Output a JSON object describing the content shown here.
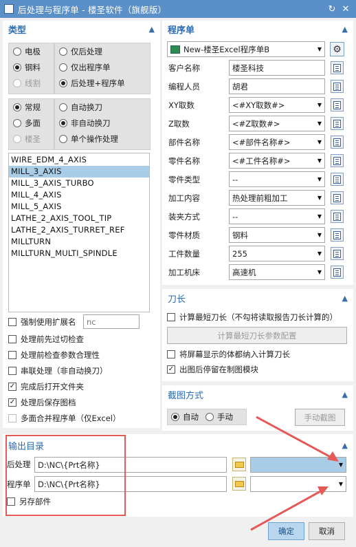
{
  "window": {
    "title": "后处理与程序单 - 楼圣软件（旗舰版）",
    "reset_icon": "refresh-icon",
    "close_icon": "close-icon"
  },
  "type_section": {
    "title": "类型",
    "radio_group1": {
      "left": [
        {
          "label": "电极",
          "checked": false,
          "disabled": false
        },
        {
          "label": "钢料",
          "checked": true,
          "disabled": false
        },
        {
          "label": "线割",
          "checked": false,
          "disabled": true
        }
      ],
      "right": [
        {
          "label": "仅后处理",
          "checked": false
        },
        {
          "label": "仅出程序单",
          "checked": false
        },
        {
          "label": "后处理+程序单",
          "checked": true
        }
      ]
    },
    "radio_group2": {
      "left": [
        {
          "label": "常规",
          "checked": true,
          "disabled": false
        },
        {
          "label": "多面",
          "checked": false,
          "disabled": false
        },
        {
          "label": "楼圣",
          "checked": false,
          "disabled": true
        }
      ],
      "right": [
        {
          "label": "自动换刀",
          "checked": false
        },
        {
          "label": "非自动换刀",
          "checked": true
        },
        {
          "label": "单个操作处理",
          "checked": false
        }
      ]
    },
    "postprocessors": [
      "WIRE_EDM_4_AXIS",
      "MILL_3_AXIS",
      "MILL_3_AXIS_TURBO",
      "MILL_4_AXIS",
      "MILL_5_AXIS",
      "LATHE_2_AXIS_TOOL_TIP",
      "LATHE_2_AXIS_TURRET_REF",
      "MILLTURN",
      "MILLTURN_MULTI_SPINDLE"
    ],
    "selected_postprocessor": "MILL_3_AXIS",
    "force_ext_label": "强制使用扩展名",
    "force_ext_value": "nc",
    "options": [
      {
        "label": "处理前先过切检查",
        "checked": false,
        "disabled": false
      },
      {
        "label": "处理前检查参数合理性",
        "checked": false,
        "disabled": false
      },
      {
        "label": "串联处理（非自动换刀）",
        "checked": false,
        "disabled": false
      },
      {
        "label": "完成后打开文件夹",
        "checked": true,
        "disabled": false
      },
      {
        "label": "处理后保存图档",
        "checked": true,
        "disabled": false
      },
      {
        "label": "多面合并程序单（仅Excel）",
        "checked": false,
        "disabled": true
      }
    ]
  },
  "program_section": {
    "title": "程序单",
    "template": "New-楼圣Excel程序单B",
    "fields": [
      {
        "label": "客户名称",
        "value": "楼圣科技",
        "dropdown": false
      },
      {
        "label": "编程人员",
        "value": "胡君",
        "dropdown": false
      },
      {
        "label": "XY取数",
        "value": "<#XY取数#>",
        "dropdown": true
      },
      {
        "label": "Z取数",
        "value": "<#Z取数#>",
        "dropdown": true
      },
      {
        "label": "部件名称",
        "value": "<#部件名称#>",
        "dropdown": true
      },
      {
        "label": "零件名称",
        "value": "<#工件名称#>",
        "dropdown": true
      },
      {
        "label": "零件类型",
        "value": "--",
        "dropdown": true
      },
      {
        "label": "加工内容",
        "value": "热处理前粗加工",
        "dropdown": true
      },
      {
        "label": "装夹方式",
        "value": "--",
        "dropdown": true
      },
      {
        "label": "零件材质",
        "value": "钢料",
        "dropdown": true
      },
      {
        "label": "工件数量",
        "value": "255",
        "dropdown": true
      },
      {
        "label": "加工机床",
        "value": "高速机",
        "dropdown": true
      }
    ]
  },
  "tool_section": {
    "title": "刀长",
    "calc_shortest_label": "计算最短刀长（不勾将读取报告刀长计算的）",
    "calc_shortest_checked": false,
    "config_button": "计算最短刀长参数配置",
    "include_body_label": "将屏幕显示的体都纳入计算刀长",
    "include_body_checked": false,
    "stay_module_label": "出图后停留在制图模块",
    "stay_module_checked": true
  },
  "screenshot_section": {
    "title": "截图方式",
    "auto_label": "自动",
    "auto_checked": true,
    "manual_label": "手动",
    "manual_checked": false,
    "manual_button": "手动截图"
  },
  "output_section": {
    "title": "输出目录",
    "post_label": "后处理",
    "post_path": "D:\\NC\\{Prt名称}",
    "program_label": "程序单",
    "program_path": "D:\\NC\\{Prt名称}",
    "save_part_label": "另存部件",
    "save_part_checked": false
  },
  "footer": {
    "ok": "确定",
    "cancel": "取消"
  },
  "colors": {
    "titlebar": "#5b8fc7",
    "section_title": "#2b6cb0",
    "highlight": "#a9cde6",
    "annotation": "#e35a57"
  }
}
